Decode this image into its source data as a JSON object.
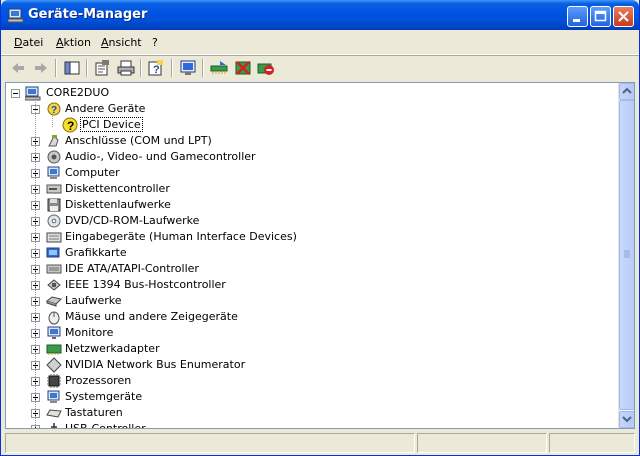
{
  "window": {
    "title": "Geräte-Manager"
  },
  "menu": [
    {
      "label": "Datei"
    },
    {
      "label": "Aktion"
    },
    {
      "label": "Ansicht"
    },
    {
      "label": "?"
    }
  ],
  "toolbar": {
    "buttons": [
      {
        "icon": "back-arrow-icon"
      },
      {
        "icon": "forward-arrow-icon"
      },
      {
        "icon": "console-tree-icon"
      },
      {
        "icon": "properties-icon"
      },
      {
        "icon": "print-icon"
      },
      {
        "icon": "help-icon"
      },
      {
        "icon": "scan-hardware-icon"
      },
      {
        "icon": "update-driver-icon"
      },
      {
        "icon": "disable-device-icon"
      },
      {
        "icon": "uninstall-device-icon"
      }
    ]
  },
  "tree": {
    "root": "CORE2DUO",
    "items": [
      {
        "label": "Andere Geräte",
        "icon": "unknown-device-icon",
        "expanded": true
      },
      {
        "label": "PCI Device",
        "icon": "warning-device-icon",
        "child": true,
        "selected": true
      },
      {
        "label": "Anschlüsse (COM und LPT)",
        "icon": "port-icon"
      },
      {
        "label": "Audio-, Video- und Gamecontroller",
        "icon": "audio-icon"
      },
      {
        "label": "Computer",
        "icon": "computer-icon"
      },
      {
        "label": "Diskettencontroller",
        "icon": "floppy-controller-icon"
      },
      {
        "label": "Diskettenlaufwerke",
        "icon": "floppy-drive-icon"
      },
      {
        "label": "DVD/CD-ROM-Laufwerke",
        "icon": "cdrom-icon"
      },
      {
        "label": "Eingabegeräte (Human Interface Devices)",
        "icon": "hid-icon"
      },
      {
        "label": "Grafikkarte",
        "icon": "display-adapter-icon"
      },
      {
        "label": "IDE ATA/ATAPI-Controller",
        "icon": "ide-controller-icon"
      },
      {
        "label": "IEEE 1394 Bus-Hostcontroller",
        "icon": "firewire-icon"
      },
      {
        "label": "Laufwerke",
        "icon": "disk-drive-icon"
      },
      {
        "label": "Mäuse und andere Zeigegeräte",
        "icon": "mouse-icon"
      },
      {
        "label": "Monitore",
        "icon": "monitor-icon"
      },
      {
        "label": "Netzwerkadapter",
        "icon": "network-adapter-icon"
      },
      {
        "label": "NVIDIA Network Bus Enumerator",
        "icon": "bus-enumerator-icon"
      },
      {
        "label": "Prozessoren",
        "icon": "processor-icon"
      },
      {
        "label": "Systemgeräte",
        "icon": "system-device-icon"
      },
      {
        "label": "Tastaturen",
        "icon": "keyboard-icon"
      },
      {
        "label": "USB-Controller",
        "icon": "usb-icon"
      }
    ]
  },
  "colors": {
    "titlebar": "#0054e3",
    "chrome": "#ece9d8",
    "tree_border": "#7f9db9"
  }
}
